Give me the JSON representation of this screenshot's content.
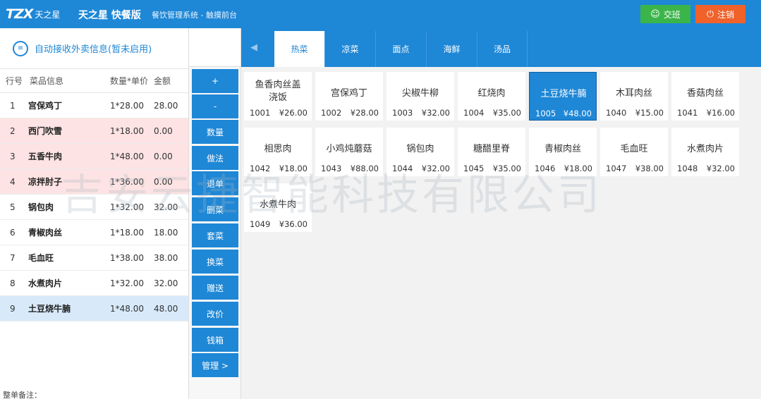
{
  "header": {
    "logo_text": "TZX",
    "logo_sub": "天之星",
    "brand": "天之星 快餐版",
    "subtitle": "餐饮管理系统 - 触摸前台",
    "btn_jiaoban": "交班",
    "btn_zhuxiao": "注销",
    "bg_color": "#1e87d6"
  },
  "order": {
    "auto_receive": "自动接收外卖信息(暂未启用)",
    "headers": {
      "no": "行号",
      "name": "菜品信息",
      "qty": "数量*单价",
      "amt": "金额"
    },
    "rows": [
      {
        "no": "1",
        "name": "宫保鸡丁",
        "qty": "1*28.00",
        "amt": "28.00"
      },
      {
        "no": "2",
        "name": "西门吹雪",
        "qty": "1*18.00",
        "amt": "0.00"
      },
      {
        "no": "3",
        "name": "五香牛肉",
        "qty": "1*48.00",
        "amt": "0.00"
      },
      {
        "no": "4",
        "name": "凉拌肘子",
        "qty": "1*36.00",
        "amt": "0.00"
      },
      {
        "no": "5",
        "name": "锅包肉",
        "qty": "1*32.00",
        "amt": "32.00"
      },
      {
        "no": "6",
        "name": "青椒肉丝",
        "qty": "1*18.00",
        "amt": "18.00"
      },
      {
        "no": "7",
        "name": "毛血旺",
        "qty": "1*38.00",
        "amt": "38.00"
      },
      {
        "no": "8",
        "name": "水煮肉片",
        "qty": "1*32.00",
        "amt": "32.00"
      },
      {
        "no": "9",
        "name": "土豆烧牛腩",
        "qty": "1*48.00",
        "amt": "48.00"
      }
    ],
    "remark_label": "整单备注："
  },
  "actions": [
    "+",
    "-",
    "数量",
    "做法",
    "退单",
    "删菜",
    "套菜",
    "换菜",
    "赠送",
    "改价",
    "钱箱",
    "管理 >"
  ],
  "tabs": [
    "热菜",
    "凉菜",
    "面点",
    "海鲜",
    "汤品"
  ],
  "dishes": [
    {
      "name": "鱼香肉丝盖浇饭",
      "name1": "鱼香肉丝盖",
      "name2": "浇饭",
      "code": "1001",
      "price": "¥26.00"
    },
    {
      "name": "宫保鸡丁",
      "code": "1002",
      "price": "¥28.00"
    },
    {
      "name": "尖椒牛柳",
      "code": "1003",
      "price": "¥32.00"
    },
    {
      "name": "红烧肉",
      "code": "1004",
      "price": "¥35.00"
    },
    {
      "name": "土豆烧牛腩",
      "code": "1005",
      "price": "¥48.00"
    },
    {
      "name": "木耳肉丝",
      "code": "1040",
      "price": "¥15.00"
    },
    {
      "name": "香菇肉丝",
      "code": "1041",
      "price": "¥16.00"
    },
    {
      "name": "相思肉",
      "code": "1042",
      "price": "¥18.00"
    },
    {
      "name": "小鸡炖蘑菇",
      "code": "1043",
      "price": "¥88.00"
    },
    {
      "name": "锅包肉",
      "code": "1044",
      "price": "¥32.00"
    },
    {
      "name": "糖醋里脊",
      "code": "1045",
      "price": "¥35.00"
    },
    {
      "name": "青椒肉丝",
      "code": "1046",
      "price": "¥18.00"
    },
    {
      "name": "毛血旺",
      "code": "1047",
      "price": "¥38.00"
    },
    {
      "name": "水煮肉片",
      "code": "1048",
      "price": "¥32.00"
    },
    {
      "name": "水煮牛肉",
      "code": "1049",
      "price": "¥36.00"
    }
  ],
  "watermark": "吉安云捷智能科技有限公司"
}
